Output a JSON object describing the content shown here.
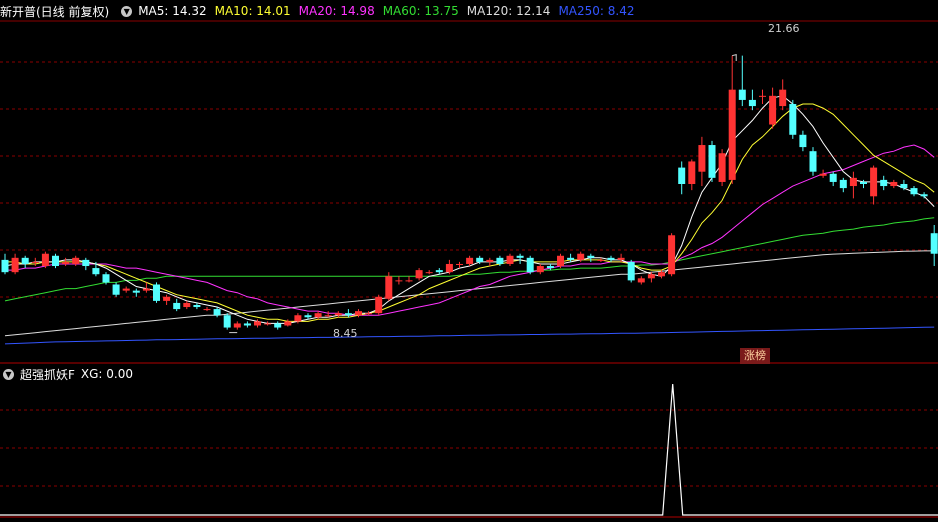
{
  "main_header": {
    "title": "新开普(日线 前复权)",
    "ma": [
      {
        "label": "MA5: 14.32",
        "color": "#ffffff"
      },
      {
        "label": "MA10: 14.01",
        "color": "#ffff33"
      },
      {
        "label": "MA20: 14.98",
        "color": "#ff33ff"
      },
      {
        "label": "MA60: 13.75",
        "color": "#33dd33"
      },
      {
        "label": "MA120: 12.14",
        "color": "#dddddd"
      },
      {
        "label": "MA250: 8.42",
        "color": "#3355ff"
      }
    ]
  },
  "sub_header": {
    "title": "超强抓妖F",
    "xg": "XG: 0.00"
  },
  "badge": "涨榜",
  "colors": {
    "up": "#ff3333",
    "down": "#54ffff",
    "grid": "#8a0000",
    "ma5": "#ffffff",
    "ma10": "#ffff33",
    "ma20": "#ff33ff",
    "ma60": "#33dd33",
    "ma120": "#dddddd",
    "ma250": "#3355ff",
    "xg": "#ffffff"
  },
  "chart_data": [
    {
      "type": "candlestick",
      "ylim": [
        7.5,
        23.3
      ],
      "high_label": "21.66",
      "low_label": "8.45",
      "candles": [
        [
          11.7,
          11.1,
          12.0,
          11.0
        ],
        [
          11.1,
          11.8,
          12.0,
          11.0
        ],
        [
          11.8,
          11.5,
          11.9,
          11.3
        ],
        [
          11.6,
          11.6,
          11.8,
          11.4
        ],
        [
          11.4,
          12.0,
          12.1,
          11.3
        ],
        [
          11.9,
          11.4,
          12.0,
          11.3
        ],
        [
          11.5,
          11.6,
          11.8,
          11.4
        ],
        [
          11.5,
          11.8,
          11.9,
          11.4
        ],
        [
          11.7,
          11.4,
          11.8,
          11.2
        ],
        [
          11.3,
          11.0,
          11.6,
          10.9
        ],
        [
          11.0,
          10.6,
          11.1,
          10.5
        ],
        [
          10.5,
          10.0,
          10.6,
          9.9
        ],
        [
          10.2,
          10.3,
          10.4,
          10.1
        ],
        [
          10.2,
          10.1,
          10.3,
          9.9
        ],
        [
          10.2,
          10.3,
          10.6,
          10.1
        ],
        [
          10.5,
          9.7,
          10.6,
          9.6
        ],
        [
          9.7,
          9.9,
          10.0,
          9.5
        ],
        [
          9.6,
          9.3,
          9.8,
          9.2
        ],
        [
          9.4,
          9.6,
          9.7,
          9.3
        ],
        [
          9.5,
          9.4,
          9.6,
          9.3
        ],
        [
          9.3,
          9.3,
          9.4,
          9.2
        ],
        [
          9.3,
          9.0,
          9.4,
          8.9
        ],
        [
          9.0,
          8.4,
          9.1,
          8.3
        ],
        [
          8.4,
          8.6,
          8.7,
          8.3
        ],
        [
          8.6,
          8.5,
          8.7,
          8.4
        ],
        [
          8.5,
          8.7,
          8.8,
          8.4
        ],
        [
          8.6,
          8.6,
          8.7,
          8.5
        ],
        [
          8.6,
          8.4,
          8.7,
          8.3
        ],
        [
          8.5,
          8.7,
          8.8,
          8.45
        ],
        [
          8.7,
          9.0,
          9.1,
          8.6
        ],
        [
          9.0,
          8.9,
          9.1,
          8.8
        ],
        [
          8.9,
          9.1,
          9.2,
          8.8
        ],
        [
          9.0,
          9.0,
          9.2,
          8.9
        ],
        [
          9.0,
          9.1,
          9.2,
          8.9
        ],
        [
          9.1,
          9.0,
          9.3,
          8.9
        ],
        [
          9.0,
          9.2,
          9.3,
          8.9
        ],
        [
          9.1,
          9.1,
          9.2,
          9.0
        ],
        [
          9.1,
          9.9,
          10.0,
          9.0
        ],
        [
          9.8,
          10.9,
          11.1,
          9.7
        ],
        [
          10.7,
          10.7,
          10.9,
          10.5
        ],
        [
          10.7,
          10.7,
          10.9,
          10.6
        ],
        [
          10.8,
          11.2,
          11.3,
          10.7
        ],
        [
          11.1,
          11.1,
          11.2,
          11.0
        ],
        [
          11.2,
          11.1,
          11.3,
          11.0
        ],
        [
          11.1,
          11.5,
          11.7,
          11.0
        ],
        [
          11.5,
          11.5,
          11.6,
          11.3
        ],
        [
          11.5,
          11.8,
          11.9,
          11.4
        ],
        [
          11.8,
          11.6,
          11.9,
          11.5
        ],
        [
          11.6,
          11.7,
          11.8,
          11.4
        ],
        [
          11.8,
          11.5,
          11.9,
          11.4
        ],
        [
          11.5,
          11.9,
          12.0,
          11.4
        ],
        [
          11.9,
          11.8,
          12.0,
          11.5
        ],
        [
          11.8,
          11.1,
          11.9,
          11.0
        ],
        [
          11.1,
          11.4,
          11.5,
          11.0
        ],
        [
          11.4,
          11.3,
          11.5,
          11.2
        ],
        [
          11.4,
          11.9,
          12.0,
          11.3
        ],
        [
          11.8,
          11.7,
          12.0,
          11.6
        ],
        [
          11.7,
          12.0,
          12.1,
          11.6
        ],
        [
          11.9,
          11.8,
          12.0,
          11.6
        ],
        [
          11.7,
          11.7,
          11.8,
          11.6
        ],
        [
          11.8,
          11.7,
          11.9,
          11.6
        ],
        [
          11.7,
          11.8,
          12.0,
          11.6
        ],
        [
          11.6,
          10.7,
          11.7,
          10.6
        ],
        [
          10.6,
          10.8,
          10.9,
          10.5
        ],
        [
          10.8,
          11.0,
          11.1,
          10.6
        ],
        [
          10.9,
          11.1,
          11.2,
          10.8
        ],
        [
          11.0,
          12.9,
          13.0,
          10.9
        ],
        [
          16.2,
          15.4,
          16.5,
          14.9
        ],
        [
          15.4,
          16.5,
          16.6,
          15.1
        ],
        [
          16.0,
          17.3,
          17.7,
          15.3
        ],
        [
          17.3,
          15.7,
          17.5,
          15.5
        ],
        [
          15.5,
          16.9,
          17.1,
          15.3
        ],
        [
          15.6,
          20.0,
          21.66,
          15.4
        ],
        [
          20.0,
          19.5,
          21.66,
          19.2
        ],
        [
          19.5,
          19.2,
          20.0,
          19.0
        ],
        [
          19.7,
          19.7,
          20.0,
          19.3
        ],
        [
          18.3,
          19.7,
          20.1,
          18.1
        ],
        [
          19.2,
          20.0,
          20.5,
          19.0
        ],
        [
          19.3,
          17.8,
          19.5,
          17.6
        ],
        [
          17.8,
          17.2,
          18.0,
          17.0
        ],
        [
          17.0,
          16.0,
          17.2,
          15.8
        ],
        [
          15.8,
          15.9,
          16.1,
          15.7
        ],
        [
          15.9,
          15.5,
          16.0,
          15.3
        ],
        [
          15.6,
          15.2,
          15.7,
          15.0
        ],
        [
          15.3,
          15.7,
          16.0,
          14.7
        ],
        [
          15.5,
          15.4,
          15.6,
          15.2
        ],
        [
          14.8,
          16.2,
          16.3,
          14.4
        ],
        [
          15.6,
          15.3,
          15.8,
          15.1
        ],
        [
          15.3,
          15.5,
          15.6,
          15.2
        ],
        [
          15.4,
          15.2,
          15.6,
          15.1
        ],
        [
          15.2,
          14.9,
          15.3,
          14.8
        ],
        [
          14.9,
          14.8,
          15.0,
          14.7
        ],
        [
          13.0,
          12.0,
          13.4,
          11.4
        ]
      ],
      "ma_series": [
        {
          "name": "MA5",
          "color": "#ffffff",
          "values": []
        },
        {
          "name": "MA10",
          "color": "#ffff33",
          "values": []
        },
        {
          "name": "MA20",
          "color": "#ff33ff",
          "values": []
        },
        {
          "name": "MA60",
          "color": "#33dd33",
          "values": []
        },
        {
          "name": "MA120",
          "color": "#dddddd",
          "values": []
        },
        {
          "name": "MA250",
          "color": "#3355ff",
          "values": []
        }
      ],
      "ma_lines": {
        "MA10": [
          11.6,
          11.6,
          11.5,
          11.5,
          11.6,
          11.6,
          11.6,
          11.6,
          11.6,
          11.5,
          11.4,
          11.2,
          11.0,
          10.8,
          10.6,
          10.4,
          10.2,
          10.0,
          9.9,
          9.8,
          9.7,
          9.6,
          9.4,
          9.2,
          9.0,
          8.9,
          8.8,
          8.8,
          8.7,
          8.7,
          8.7,
          8.8,
          8.8,
          8.9,
          8.9,
          9.0,
          9.1,
          9.2,
          9.4,
          9.6,
          9.8,
          10.0,
          10.3,
          10.5,
          10.7,
          10.9,
          11.1,
          11.3,
          11.4,
          11.5,
          11.6,
          11.7,
          11.6,
          11.6,
          11.6,
          11.6,
          11.7,
          11.7,
          11.7,
          11.7,
          11.6,
          11.6,
          11.5,
          11.3,
          11.2,
          11.2,
          11.4,
          12.0,
          12.7,
          13.5,
          14.0,
          14.6,
          15.6,
          16.6,
          17.3,
          17.7,
          18.2,
          18.7,
          19.1,
          19.3,
          19.3,
          19.1,
          18.8,
          18.3,
          17.8,
          17.3,
          16.8,
          16.5,
          16.2,
          15.9,
          15.6,
          15.4,
          15.0
        ],
        "MA20": [
          11.2,
          11.2,
          11.3,
          11.3,
          11.4,
          11.5,
          11.5,
          11.5,
          11.5,
          11.5,
          11.5,
          11.4,
          11.3,
          11.3,
          11.2,
          11.1,
          11.0,
          10.9,
          10.8,
          10.7,
          10.6,
          10.4,
          10.2,
          10.1,
          9.9,
          9.8,
          9.6,
          9.5,
          9.4,
          9.3,
          9.2,
          9.2,
          9.1,
          9.1,
          9.0,
          9.0,
          9.0,
          9.0,
          9.1,
          9.2,
          9.3,
          9.4,
          9.5,
          9.6,
          9.8,
          10.0,
          10.2,
          10.4,
          10.5,
          10.7,
          10.9,
          11.0,
          11.1,
          11.2,
          11.3,
          11.4,
          11.4,
          11.5,
          11.5,
          11.5,
          11.6,
          11.6,
          11.6,
          11.6,
          11.5,
          11.5,
          11.5,
          11.8,
          12.0,
          12.3,
          12.5,
          12.8,
          13.2,
          13.6,
          14.0,
          14.4,
          14.7,
          15.0,
          15.3,
          15.5,
          15.7,
          15.9,
          16.0,
          16.1,
          16.3,
          16.5,
          16.7,
          16.9,
          17.0,
          17.2,
          17.3,
          17.1,
          16.7
        ],
        "MA5": [
          11.4,
          11.5,
          11.5,
          11.6,
          11.6,
          11.6,
          11.7,
          11.7,
          11.6,
          11.5,
          11.3,
          11.0,
          10.7,
          10.4,
          10.3,
          10.2,
          10.1,
          9.9,
          9.7,
          9.6,
          9.5,
          9.4,
          9.2,
          9.0,
          8.8,
          8.7,
          8.6,
          8.6,
          8.6,
          8.7,
          8.8,
          8.9,
          8.9,
          9.0,
          9.0,
          9.1,
          9.1,
          9.3,
          9.7,
          10.0,
          10.3,
          10.6,
          10.9,
          11.0,
          11.1,
          11.3,
          11.4,
          11.6,
          11.6,
          11.6,
          11.7,
          11.7,
          11.6,
          11.5,
          11.5,
          11.5,
          11.6,
          11.7,
          11.8,
          11.8,
          11.7,
          11.7,
          11.5,
          11.2,
          11.0,
          10.9,
          11.4,
          12.4,
          13.8,
          15.0,
          15.7,
          16.4,
          17.5,
          18.0,
          18.5,
          19.1,
          19.6,
          19.7,
          19.3,
          18.8,
          18.2,
          17.4,
          16.7,
          16.0,
          15.6,
          15.5,
          15.5,
          15.5,
          15.4,
          15.2,
          15.0,
          14.8,
          14.3
        ],
        "MA60": [
          9.7,
          9.8,
          9.9,
          10.0,
          10.1,
          10.2,
          10.3,
          10.3,
          10.4,
          10.5,
          10.6,
          10.6,
          10.7,
          10.7,
          10.8,
          10.8,
          10.9,
          10.9,
          10.9,
          10.9,
          10.9,
          10.9,
          10.9,
          10.9,
          10.9,
          10.9,
          10.9,
          10.9,
          10.9,
          10.9,
          10.9,
          10.9,
          10.9,
          10.9,
          10.9,
          10.9,
          10.9,
          10.9,
          10.9,
          10.9,
          10.9,
          10.9,
          10.9,
          10.9,
          10.9,
          10.95,
          11.0,
          11.0,
          11.05,
          11.1,
          11.1,
          11.15,
          11.15,
          11.2,
          11.2,
          11.25,
          11.25,
          11.3,
          11.3,
          11.3,
          11.35,
          11.4,
          11.4,
          11.45,
          11.45,
          11.5,
          11.6,
          11.7,
          11.8,
          11.9,
          12.0,
          12.1,
          12.2,
          12.3,
          12.4,
          12.5,
          12.6,
          12.7,
          12.8,
          12.9,
          12.95,
          13.0,
          13.1,
          13.15,
          13.2,
          13.3,
          13.35,
          13.4,
          13.5,
          13.55,
          13.6,
          13.7,
          13.75
        ],
        "MA120": [
          8.0,
          8.05,
          8.1,
          8.15,
          8.2,
          8.25,
          8.3,
          8.35,
          8.4,
          8.45,
          8.5,
          8.55,
          8.6,
          8.65,
          8.7,
          8.75,
          8.8,
          8.85,
          8.9,
          8.95,
          9.0,
          9.0,
          9.05,
          9.1,
          9.15,
          9.2,
          9.25,
          9.3,
          9.35,
          9.4,
          9.45,
          9.5,
          9.55,
          9.6,
          9.65,
          9.7,
          9.75,
          9.8,
          9.85,
          9.9,
          9.95,
          10.0,
          10.05,
          10.1,
          10.15,
          10.2,
          10.25,
          10.3,
          10.35,
          10.4,
          10.45,
          10.5,
          10.55,
          10.6,
          10.65,
          10.7,
          10.75,
          10.8,
          10.85,
          10.9,
          10.95,
          11.0,
          11.0,
          11.05,
          11.1,
          11.15,
          11.2,
          11.25,
          11.3,
          11.35,
          11.4,
          11.45,
          11.5,
          11.55,
          11.6,
          11.65,
          11.7,
          11.75,
          11.8,
          11.85,
          11.9,
          11.95,
          11.98,
          12.0,
          12.02,
          12.04,
          12.06,
          12.08,
          12.1,
          12.12,
          12.13,
          12.14,
          12.14
        ],
        "MA250": [
          7.6,
          7.62,
          7.64,
          7.66,
          7.68,
          7.7,
          7.71,
          7.72,
          7.73,
          7.74,
          7.75,
          7.76,
          7.77,
          7.78,
          7.79,
          7.8,
          7.8,
          7.81,
          7.82,
          7.83,
          7.84,
          7.85,
          7.85,
          7.86,
          7.87,
          7.88,
          7.88,
          7.89,
          7.9,
          7.9,
          7.91,
          7.92,
          7.92,
          7.93,
          7.94,
          7.94,
          7.95,
          7.96,
          7.96,
          7.97,
          7.98,
          7.98,
          7.99,
          8.0,
          8.0,
          8.01,
          8.02,
          8.02,
          8.03,
          8.04,
          8.04,
          8.05,
          8.06,
          8.06,
          8.07,
          8.08,
          8.08,
          8.09,
          8.1,
          8.1,
          8.11,
          8.12,
          8.12,
          8.13,
          8.14,
          8.15,
          8.16,
          8.17,
          8.18,
          8.19,
          8.2,
          8.21,
          8.22,
          8.23,
          8.24,
          8.25,
          8.26,
          8.27,
          8.28,
          8.29,
          8.3,
          8.31,
          8.32,
          8.33,
          8.34,
          8.35,
          8.36,
          8.37,
          8.38,
          8.39,
          8.4,
          8.41,
          8.42
        ]
      }
    },
    {
      "type": "line",
      "name": "XG",
      "ylim": [
        0,
        1
      ],
      "values_note_index_of_spike": 67,
      "values": []
    }
  ]
}
